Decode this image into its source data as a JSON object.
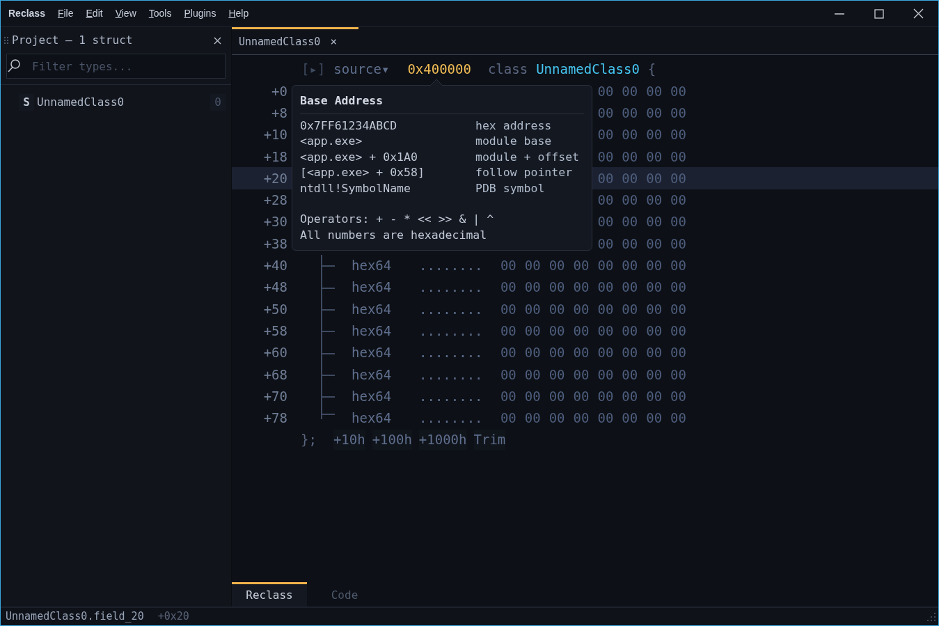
{
  "window": {
    "app_name": "Reclass",
    "menu": [
      "File",
      "Edit",
      "View",
      "Tools",
      "Plugins",
      "Help"
    ]
  },
  "project_panel": {
    "title": "Project — 1 struct",
    "filter": {
      "placeholder": "Filter types..."
    },
    "items": [
      {
        "badge": "S",
        "name": "UnnamedClass0",
        "count": "0"
      }
    ]
  },
  "editor_tabs": [
    {
      "label": "UnnamedClass0",
      "close": "×",
      "selected": true
    }
  ],
  "header": {
    "toggle": "[▸]",
    "source": "source▾",
    "address": "0x400000",
    "keyword": "class",
    "class_name": "UnnamedClass0",
    "brace": "{"
  },
  "rows": [
    {
      "offset": "+0",
      "selected": false,
      "bytes": [
        "00",
        "00",
        "00",
        "00"
      ]
    },
    {
      "offset": "+8",
      "selected": false,
      "bytes": [
        "00",
        "00",
        "00",
        "00"
      ]
    },
    {
      "offset": "+10",
      "selected": false,
      "bytes": [
        "00",
        "00",
        "00",
        "00"
      ]
    },
    {
      "offset": "+18",
      "selected": false,
      "bytes": [
        "00",
        "00",
        "00",
        "00"
      ]
    },
    {
      "offset": "+20",
      "selected": true,
      "bytes": [
        "00",
        "00",
        "00",
        "00"
      ]
    },
    {
      "offset": "+28",
      "selected": false,
      "bytes": [
        "00",
        "00",
        "00",
        "00"
      ]
    },
    {
      "offset": "+30",
      "selected": false,
      "bytes": [
        "00",
        "00",
        "00",
        "00"
      ]
    },
    {
      "offset": "+38",
      "selected": false,
      "bytes": [
        "00",
        "00",
        "00",
        "00"
      ]
    },
    {
      "offset": "+40",
      "selected": false,
      "kind": "tee",
      "type": "hex64",
      "ascii": "........",
      "bytes": [
        "00",
        "00",
        "00",
        "00",
        "00",
        "00",
        "00",
        "00"
      ]
    },
    {
      "offset": "+48",
      "selected": false,
      "kind": "tee",
      "type": "hex64",
      "ascii": "........",
      "bytes": [
        "00",
        "00",
        "00",
        "00",
        "00",
        "00",
        "00",
        "00"
      ]
    },
    {
      "offset": "+50",
      "selected": false,
      "kind": "tee",
      "type": "hex64",
      "ascii": "........",
      "bytes": [
        "00",
        "00",
        "00",
        "00",
        "00",
        "00",
        "00",
        "00"
      ]
    },
    {
      "offset": "+58",
      "selected": false,
      "kind": "tee",
      "type": "hex64",
      "ascii": "........",
      "bytes": [
        "00",
        "00",
        "00",
        "00",
        "00",
        "00",
        "00",
        "00"
      ]
    },
    {
      "offset": "+60",
      "selected": false,
      "kind": "tee",
      "type": "hex64",
      "ascii": "........",
      "bytes": [
        "00",
        "00",
        "00",
        "00",
        "00",
        "00",
        "00",
        "00"
      ]
    },
    {
      "offset": "+68",
      "selected": false,
      "kind": "tee",
      "type": "hex64",
      "ascii": "........",
      "bytes": [
        "00",
        "00",
        "00",
        "00",
        "00",
        "00",
        "00",
        "00"
      ]
    },
    {
      "offset": "+70",
      "selected": false,
      "kind": "tee",
      "type": "hex64",
      "ascii": "........",
      "bytes": [
        "00",
        "00",
        "00",
        "00",
        "00",
        "00",
        "00",
        "00"
      ]
    },
    {
      "offset": "+78",
      "selected": false,
      "kind": "end",
      "type": "hex64",
      "ascii": "........",
      "bytes": [
        "00",
        "00",
        "00",
        "00",
        "00",
        "00",
        "00",
        "00"
      ]
    }
  ],
  "footer": {
    "close": "};",
    "buttons": [
      "+10h",
      "+100h",
      "+1000h",
      "Trim"
    ]
  },
  "tooltip": {
    "title": "Base Address",
    "examples": [
      {
        "syntax": "0x7FF61234ABCD",
        "meaning": "hex address"
      },
      {
        "syntax": "<app.exe>",
        "meaning": "module base"
      },
      {
        "syntax": "<app.exe> + 0x1A0",
        "meaning": "module + offset"
      },
      {
        "syntax": "[<app.exe> + 0x58]",
        "meaning": "follow pointer"
      },
      {
        "syntax": "ntdll!SymbolName",
        "meaning": "PDB symbol"
      }
    ],
    "notes": [
      "Operators: + - * << >> & | ^",
      "All numbers are hexadecimal"
    ]
  },
  "bottom_tabs": [
    {
      "label": "Reclass",
      "selected": true
    },
    {
      "label": "Code",
      "selected": false
    }
  ],
  "status_bar": {
    "path": "UnnamedClass0.field_20",
    "offset": "+0x20"
  }
}
